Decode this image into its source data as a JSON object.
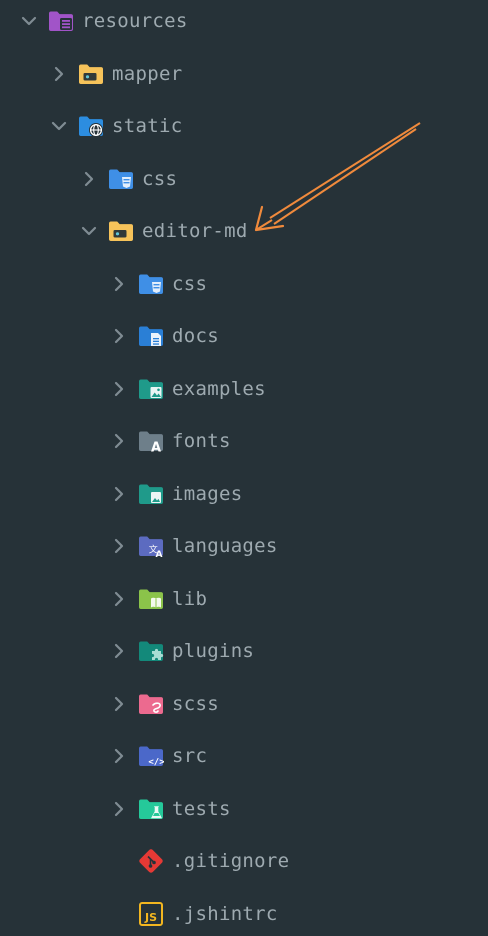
{
  "colors": {
    "background": "#263238",
    "text": "#9eaab0",
    "chevron": "#7f8c93",
    "arrow": "#f08a3c"
  },
  "tree": [
    {
      "name": "resources",
      "depth": 0,
      "expanded": true,
      "icon": "folder-resources-icon",
      "color": "#a154c8"
    },
    {
      "name": "mapper",
      "depth": 1,
      "expanded": false,
      "icon": "folder-icon",
      "color": "#f6c35a"
    },
    {
      "name": "static",
      "depth": 1,
      "expanded": true,
      "icon": "folder-public-icon",
      "color": "#2c8de0"
    },
    {
      "name": "css",
      "depth": 2,
      "expanded": false,
      "icon": "folder-css-icon",
      "color": "#3f8fe6"
    },
    {
      "name": "editor-md",
      "depth": 2,
      "expanded": true,
      "icon": "folder-icon",
      "color": "#f6c35a"
    },
    {
      "name": "css",
      "depth": 3,
      "expanded": false,
      "icon": "folder-css-icon",
      "color": "#3f8fe6"
    },
    {
      "name": "docs",
      "depth": 3,
      "expanded": false,
      "icon": "folder-docs-icon",
      "color": "#2a7fd6"
    },
    {
      "name": "examples",
      "depth": 3,
      "expanded": false,
      "icon": "folder-examples-icon",
      "color": "#1f9a8a"
    },
    {
      "name": "fonts",
      "depth": 3,
      "expanded": false,
      "icon": "folder-fonts-icon",
      "color": "#6e7f8a"
    },
    {
      "name": "images",
      "depth": 3,
      "expanded": false,
      "icon": "folder-images-icon",
      "color": "#1f9a8a"
    },
    {
      "name": "languages",
      "depth": 3,
      "expanded": false,
      "icon": "folder-i18n-icon",
      "color": "#5c6bc0"
    },
    {
      "name": "lib",
      "depth": 3,
      "expanded": false,
      "icon": "folder-lib-icon",
      "color": "#8bc34a"
    },
    {
      "name": "plugins",
      "depth": 3,
      "expanded": false,
      "icon": "folder-plugins-icon",
      "color": "#13897a"
    },
    {
      "name": "scss",
      "depth": 3,
      "expanded": false,
      "icon": "folder-sass-icon",
      "color": "#ec6a8f"
    },
    {
      "name": "src",
      "depth": 3,
      "expanded": false,
      "icon": "folder-src-icon",
      "color": "#4b68c9"
    },
    {
      "name": "tests",
      "depth": 3,
      "expanded": false,
      "icon": "folder-test-icon",
      "color": "#25c99a"
    },
    {
      "name": ".gitignore",
      "depth": 3,
      "file": true,
      "icon": "git-icon",
      "color": "#e53935"
    },
    {
      "name": ".jshintrc",
      "depth": 3,
      "file": true,
      "icon": "javascript-icon",
      "color": "#f2b620"
    }
  ]
}
